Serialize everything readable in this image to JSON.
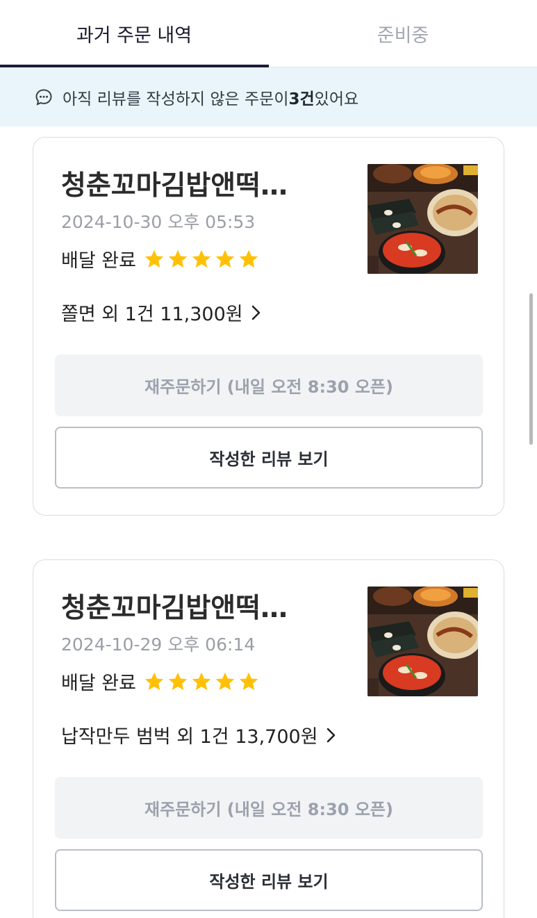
{
  "tabs": [
    {
      "label": "과거 주문 내역",
      "active": true
    },
    {
      "label": "준비중",
      "active": false
    }
  ],
  "notice": {
    "prefix": "아직 리뷰를 작성하지 않은 주문이 ",
    "count": "3건",
    "suffix": " 있어요",
    "icon": "chat-bubble-icon"
  },
  "orders": [
    {
      "store": "청춘꼬마김밥앤떡…",
      "date": "2024-10-30 오후 05:53",
      "status": "배달 완료",
      "rating": 5,
      "summary": "쫄면 외 1건 11,300원",
      "reorder_label": "재주문하기 (내일 오전 8:30 오픈)",
      "review_label": "작성한 리뷰 보기"
    },
    {
      "store": "청춘꼬마김밥앤떡…",
      "date": "2024-10-29 오후 06:14",
      "status": "배달 완료",
      "rating": 5,
      "summary": "납작만두 범벅 외 1건 13,700원",
      "reorder_label": "재주문하기 (내일 오전 8:30 오픈)",
      "review_label": "작성한 리뷰 보기"
    }
  ],
  "colors": {
    "accent": "#1b1b3a",
    "star": "#ffc107",
    "notice_bg": "#e9f5fb"
  }
}
